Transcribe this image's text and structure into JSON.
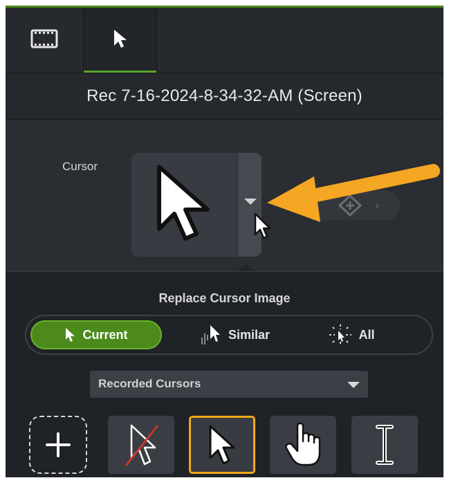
{
  "tabs": [
    {
      "name": "Visual Properties",
      "icon": "film-strip-icon"
    },
    {
      "name": "Cursor Properties",
      "icon": "cursor-arrow-icon",
      "active": true
    }
  ],
  "header": {
    "title": "Rec 7-16-2024-8-34-32-AM (Screen)"
  },
  "cursor_property": {
    "label": "Cursor",
    "preview_icon": "cursor-arrow-icon"
  },
  "keyframe_nav": {
    "prev": "‹",
    "next": "›",
    "add_icon": "add-keyframe-icon"
  },
  "popup": {
    "title": "Replace Cursor Image",
    "scope_options": [
      {
        "label": "Current",
        "selected": true,
        "icon": "cursor-arrow-icon"
      },
      {
        "label": "Similar",
        "selected": false,
        "icon": "similar-cursors-icon"
      },
      {
        "label": "All",
        "selected": false,
        "icon": "all-cursors-icon"
      }
    ],
    "source": {
      "selected": "Recorded Cursors"
    },
    "cursor_options": [
      {
        "icon": "add-cursor-icon"
      },
      {
        "icon": "no-cursor-icon"
      },
      {
        "icon": "arrow-cursor-icon",
        "selected": true
      },
      {
        "icon": "hand-cursor-icon"
      },
      {
        "icon": "ibeam-cursor-icon"
      }
    ]
  },
  "colors": {
    "accent": "#5ba52a",
    "selected_outline": "#f0a818",
    "annotation_arrow": "#f5a623",
    "panel": "#202428"
  }
}
